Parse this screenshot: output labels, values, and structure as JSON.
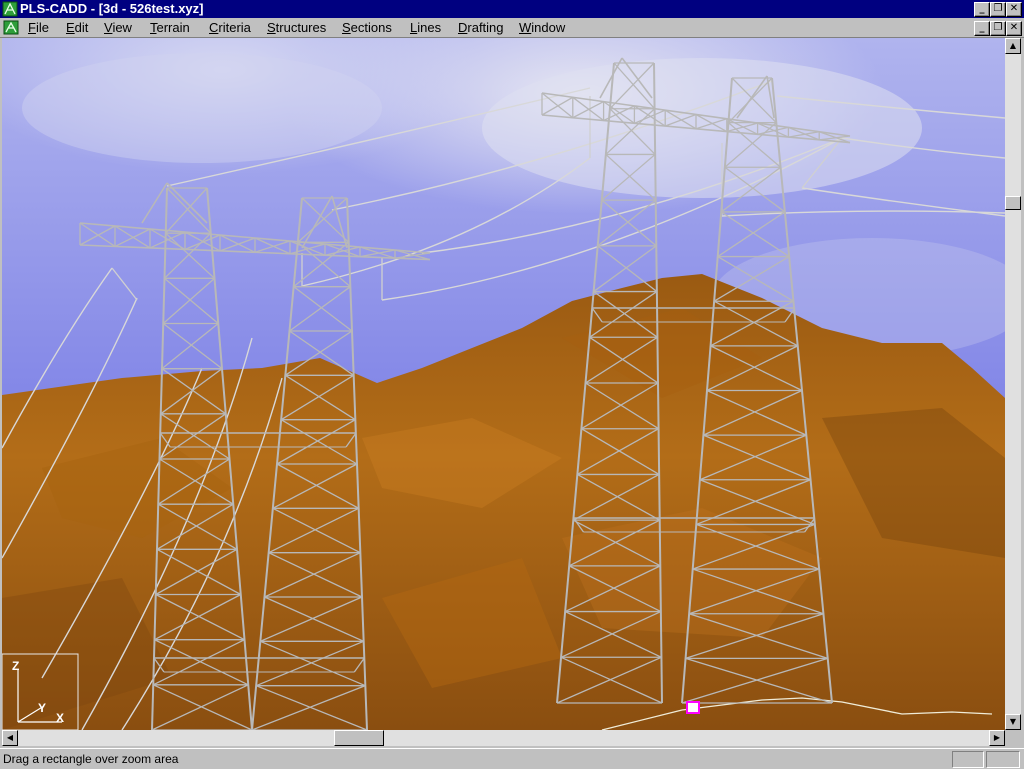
{
  "window": {
    "title": "PLS-CADD - [3d - 526test.xyz]",
    "controls": {
      "minimize": "_",
      "restore": "❐",
      "close": "✕"
    }
  },
  "menu": {
    "items": [
      "File",
      "Edit",
      "View",
      "Terrain",
      "Criteria",
      "Structures",
      "Sections",
      "Lines",
      "Drafting",
      "Window"
    ]
  },
  "viewport": {
    "axis_labels": {
      "z": "Z",
      "y": "Y",
      "x": "X"
    },
    "colors": {
      "sky": "#8c90e8",
      "terrain": "#b06b17",
      "tower": "#b8b8b8",
      "wire": "#d8d8d8"
    }
  },
  "status": {
    "message": "Drag a rectangle over zoom area"
  },
  "icons": {
    "app": "pls-cadd-app-icon",
    "doc": "3d-view-icon",
    "scroll_up": "arrow-up-icon",
    "scroll_down": "arrow-down-icon",
    "scroll_left": "arrow-left-icon",
    "scroll_right": "arrow-right-icon",
    "cursor": "selection-marker-icon"
  }
}
